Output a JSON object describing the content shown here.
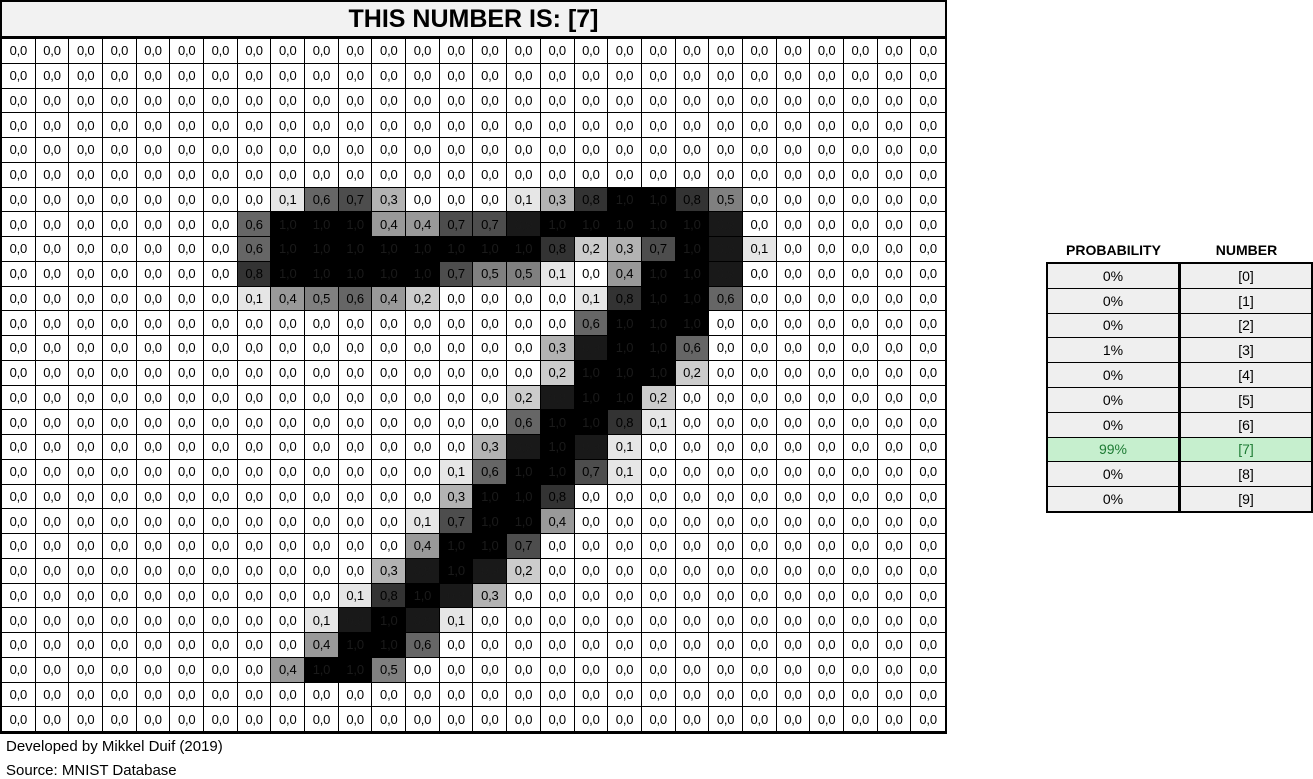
{
  "title": "THIS NUMBER IS: [7]",
  "grid": {
    "rows": 28,
    "cols": 28,
    "nonzero": [
      [
        6,
        8,
        "0,1"
      ],
      [
        6,
        9,
        "0,6"
      ],
      [
        6,
        10,
        "0,7"
      ],
      [
        6,
        11,
        "0,3"
      ],
      [
        6,
        15,
        "0,1"
      ],
      [
        6,
        16,
        "0,3"
      ],
      [
        6,
        17,
        "0,8"
      ],
      [
        6,
        18,
        "1,0"
      ],
      [
        6,
        19,
        "1,0"
      ],
      [
        6,
        20,
        "0,8"
      ],
      [
        6,
        21,
        "0,5"
      ],
      [
        7,
        7,
        "0,6"
      ],
      [
        7,
        8,
        "1,0"
      ],
      [
        7,
        9,
        "1,0"
      ],
      [
        7,
        10,
        "1,0"
      ],
      [
        7,
        11,
        "0,4"
      ],
      [
        7,
        12,
        "0,4"
      ],
      [
        7,
        13,
        "0,7"
      ],
      [
        7,
        14,
        "0,7"
      ],
      [
        7,
        15,
        "0,9"
      ],
      [
        7,
        16,
        "1,0"
      ],
      [
        7,
        17,
        "1,0"
      ],
      [
        7,
        18,
        "1,0"
      ],
      [
        7,
        19,
        "1,0"
      ],
      [
        7,
        20,
        "1,0"
      ],
      [
        7,
        21,
        "0,9"
      ],
      [
        8,
        7,
        "0,6"
      ],
      [
        8,
        8,
        "1,0"
      ],
      [
        8,
        9,
        "1,0"
      ],
      [
        8,
        10,
        "1,0"
      ],
      [
        8,
        11,
        "1,0"
      ],
      [
        8,
        12,
        "1,0"
      ],
      [
        8,
        13,
        "1,0"
      ],
      [
        8,
        14,
        "1,0"
      ],
      [
        8,
        15,
        "1,0"
      ],
      [
        8,
        16,
        "0,8"
      ],
      [
        8,
        17,
        "0,2"
      ],
      [
        8,
        18,
        "0,3"
      ],
      [
        8,
        19,
        "0,7"
      ],
      [
        8,
        20,
        "1,0"
      ],
      [
        8,
        21,
        "0,9"
      ],
      [
        8,
        22,
        "0,1"
      ],
      [
        9,
        7,
        "0,8"
      ],
      [
        9,
        8,
        "1,0"
      ],
      [
        9,
        9,
        "1,0"
      ],
      [
        9,
        10,
        "1,0"
      ],
      [
        9,
        11,
        "1,0"
      ],
      [
        9,
        12,
        "1,0"
      ],
      [
        9,
        13,
        "0,7"
      ],
      [
        9,
        14,
        "0,5"
      ],
      [
        9,
        15,
        "0,5"
      ],
      [
        9,
        16,
        "0,1"
      ],
      [
        9,
        18,
        "0,4"
      ],
      [
        9,
        19,
        "1,0"
      ],
      [
        9,
        20,
        "1,0"
      ],
      [
        9,
        21,
        "0,9"
      ],
      [
        10,
        7,
        "0,1"
      ],
      [
        10,
        8,
        "0,4"
      ],
      [
        10,
        9,
        "0,5"
      ],
      [
        10,
        10,
        "0,6"
      ],
      [
        10,
        11,
        "0,4"
      ],
      [
        10,
        12,
        "0,2"
      ],
      [
        10,
        17,
        "0,1"
      ],
      [
        10,
        18,
        "0,8"
      ],
      [
        10,
        19,
        "1,0"
      ],
      [
        10,
        20,
        "1,0"
      ],
      [
        10,
        21,
        "0,6"
      ],
      [
        11,
        17,
        "0,6"
      ],
      [
        11,
        18,
        "1,0"
      ],
      [
        11,
        19,
        "1,0"
      ],
      [
        11,
        20,
        "1,0"
      ],
      [
        12,
        16,
        "0,3"
      ],
      [
        12,
        17,
        "0,9"
      ],
      [
        12,
        18,
        "1,0"
      ],
      [
        12,
        19,
        "1,0"
      ],
      [
        12,
        20,
        "0,6"
      ],
      [
        13,
        16,
        "0,2"
      ],
      [
        13,
        17,
        "1,0"
      ],
      [
        13,
        18,
        "1,0"
      ],
      [
        13,
        19,
        "1,0"
      ],
      [
        13,
        20,
        "0,2"
      ],
      [
        14,
        15,
        "0,2"
      ],
      [
        14,
        16,
        "0,9"
      ],
      [
        14,
        17,
        "1,0"
      ],
      [
        14,
        18,
        "1,0"
      ],
      [
        14,
        19,
        "0,2"
      ],
      [
        15,
        15,
        "0,6"
      ],
      [
        15,
        16,
        "1,0"
      ],
      [
        15,
        17,
        "1,0"
      ],
      [
        15,
        18,
        "0,8"
      ],
      [
        15,
        19,
        "0,1"
      ],
      [
        16,
        14,
        "0,3"
      ],
      [
        16,
        15,
        "0,9"
      ],
      [
        16,
        16,
        "1,0"
      ],
      [
        16,
        17,
        "0,9"
      ],
      [
        16,
        18,
        "0,1"
      ],
      [
        17,
        13,
        "0,1"
      ],
      [
        17,
        14,
        "0,6"
      ],
      [
        17,
        15,
        "1,0"
      ],
      [
        17,
        16,
        "1,0"
      ],
      [
        17,
        17,
        "0,7"
      ],
      [
        17,
        18,
        "0,1"
      ],
      [
        18,
        13,
        "0,3"
      ],
      [
        18,
        14,
        "1,0"
      ],
      [
        18,
        15,
        "1,0"
      ],
      [
        18,
        16,
        "0,8"
      ],
      [
        19,
        12,
        "0,1"
      ],
      [
        19,
        13,
        "0,7"
      ],
      [
        19,
        14,
        "1,0"
      ],
      [
        19,
        15,
        "1,0"
      ],
      [
        19,
        16,
        "0,4"
      ],
      [
        20,
        12,
        "0,4"
      ],
      [
        20,
        13,
        "1,0"
      ],
      [
        20,
        14,
        "1,0"
      ],
      [
        20,
        15,
        "0,7"
      ],
      [
        21,
        11,
        "0,3"
      ],
      [
        21,
        12,
        "0,9"
      ],
      [
        21,
        13,
        "1,0"
      ],
      [
        21,
        14,
        "0,9"
      ],
      [
        21,
        15,
        "0,2"
      ],
      [
        22,
        10,
        "0,1"
      ],
      [
        22,
        11,
        "0,8"
      ],
      [
        22,
        12,
        "1,0"
      ],
      [
        22,
        13,
        "0,9"
      ],
      [
        22,
        14,
        "0,3"
      ],
      [
        23,
        9,
        "0,1"
      ],
      [
        23,
        10,
        "0,9"
      ],
      [
        23,
        11,
        "1,0"
      ],
      [
        23,
        12,
        "0,9"
      ],
      [
        23,
        13,
        "0,1"
      ],
      [
        24,
        9,
        "0,4"
      ],
      [
        24,
        10,
        "1,0"
      ],
      [
        24,
        11,
        "1,0"
      ],
      [
        24,
        12,
        "0,6"
      ],
      [
        25,
        8,
        "0,4"
      ],
      [
        25,
        9,
        "1,0"
      ],
      [
        25,
        10,
        "1,0"
      ],
      [
        25,
        11,
        "0,5"
      ]
    ]
  },
  "credits": {
    "developer": "Developed by Mikkel Duif (2019)",
    "source": "Source: MNIST Database"
  },
  "probability_table": {
    "headers": {
      "probability": "PROBABILITY",
      "number": "NUMBER"
    },
    "rows": [
      {
        "probability": "0%",
        "number": "[0]"
      },
      {
        "probability": "0%",
        "number": "[1]"
      },
      {
        "probability": "0%",
        "number": "[2]"
      },
      {
        "probability": "1%",
        "number": "[3]"
      },
      {
        "probability": "0%",
        "number": "[4]"
      },
      {
        "probability": "0%",
        "number": "[5]"
      },
      {
        "probability": "0%",
        "number": "[6]"
      },
      {
        "probability": "99%",
        "number": "[7]",
        "highlight": true
      },
      {
        "probability": "0%",
        "number": "[8]"
      },
      {
        "probability": "0%",
        "number": "[9]"
      }
    ]
  },
  "colors": {
    "highlight_fill": "#c6efce",
    "highlight_text": "#1e7b34",
    "table_fill": "#efefef"
  }
}
